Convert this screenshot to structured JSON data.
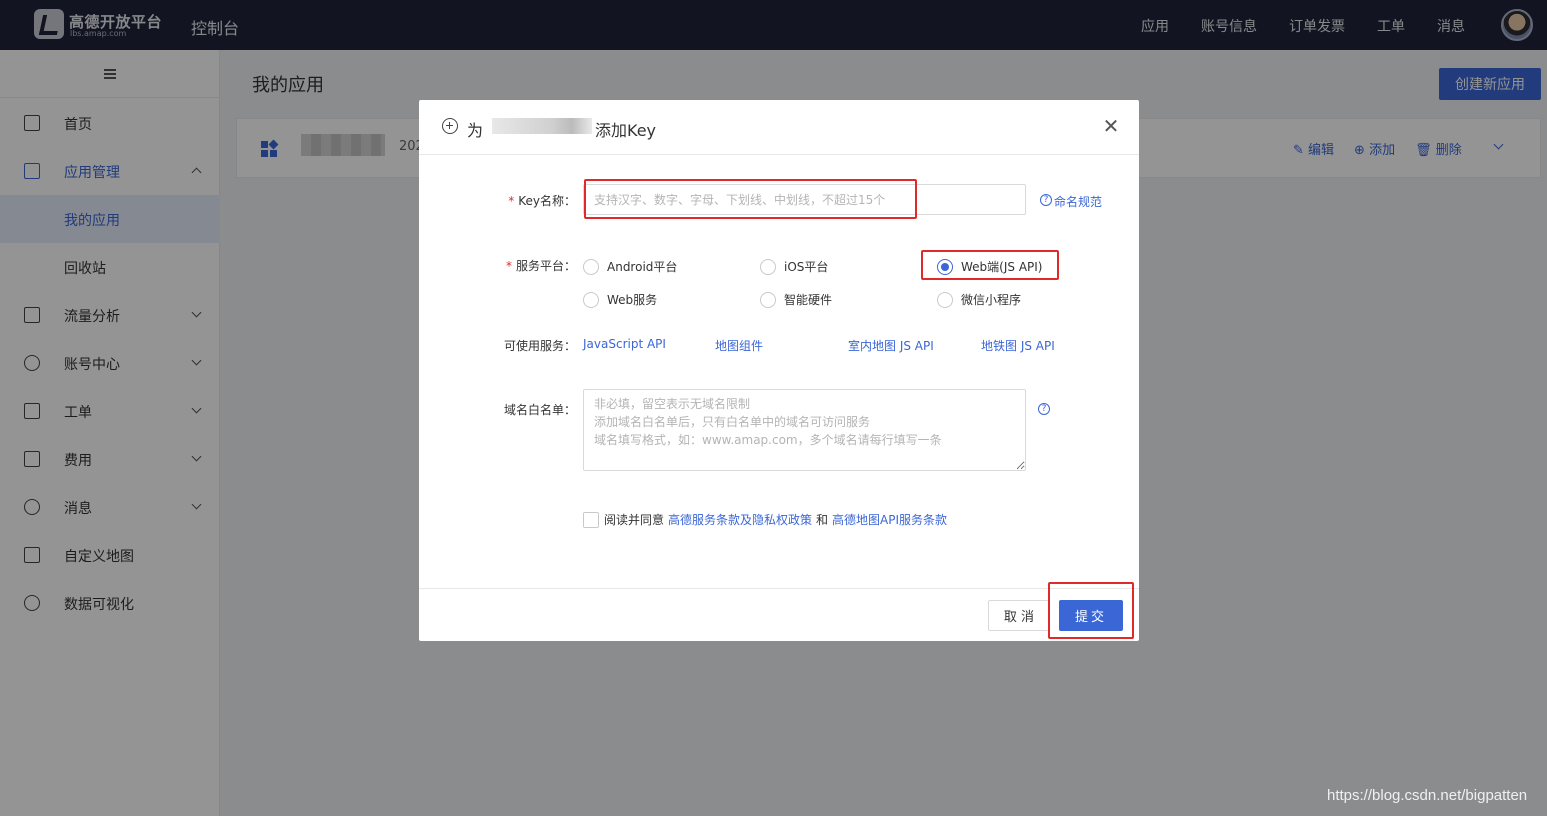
{
  "header": {
    "logo_title": "高德开放平台",
    "logo_sub": "lbs.amap.com",
    "console": "控制台",
    "nav": [
      "应用",
      "账号信息",
      "订单发票",
      "工单",
      "消息"
    ]
  },
  "sidebar": {
    "items": [
      {
        "label": "首页",
        "icon": "home-icon"
      },
      {
        "label": "应用管理",
        "icon": "app-grid-icon"
      },
      {
        "label": "我的应用"
      },
      {
        "label": "回收站"
      },
      {
        "label": "流量分析",
        "icon": "chart-icon"
      },
      {
        "label": "账号中心",
        "icon": "user-icon"
      },
      {
        "label": "工单",
        "icon": "ticket-icon"
      },
      {
        "label": "费用",
        "icon": "yen-icon"
      },
      {
        "label": "消息",
        "icon": "message-icon"
      },
      {
        "label": "自定义地图",
        "icon": "map-icon"
      },
      {
        "label": "数据可视化",
        "icon": "visual-icon"
      }
    ]
  },
  "main": {
    "title": "我的应用",
    "create_button": "创建新应用",
    "card": {
      "date": "202",
      "actions": [
        "编辑",
        "添加",
        "删除"
      ]
    }
  },
  "modal": {
    "title_prefix": "为",
    "title_suffix": "添加Key",
    "key_name_label": "Key名称：",
    "key_name_placeholder": "支持汉字、数字、字母、下划线、中划线，不超过15个",
    "naming_rule": "命名规范",
    "platform_label": "服务平台：",
    "platforms": [
      {
        "label": "Android平台",
        "checked": false
      },
      {
        "label": "iOS平台",
        "checked": false
      },
      {
        "label": "Web端(JS API)",
        "checked": true
      },
      {
        "label": "Web服务",
        "checked": false
      },
      {
        "label": "智能硬件",
        "checked": false
      },
      {
        "label": "微信小程序",
        "checked": false
      }
    ],
    "services_label": "可使用服务：",
    "services": [
      "JavaScript API",
      "地图组件",
      "室内地图 JS API",
      "地铁图 JS API"
    ],
    "whitelist_label": "域名白名单：",
    "whitelist_placeholder": "非必填，留空表示无域名限制\n添加域名白名单后，只有白名单中的域名可访问服务\n域名填写格式，如：www.amap.com，多个域名请每行填写一条",
    "agree_text": "阅读并同意",
    "agree_link1": "高德服务条款及隐私权政策",
    "agree_and": "和",
    "agree_link2": "高德地图API服务条款",
    "cancel": "取 消",
    "submit": "提交"
  },
  "watermark": "https://blog.csdn.net/bigpatten",
  "colors": {
    "accent": "#3a66d6",
    "header_bg": "#1f2539",
    "highlight": "#e02a2a"
  }
}
